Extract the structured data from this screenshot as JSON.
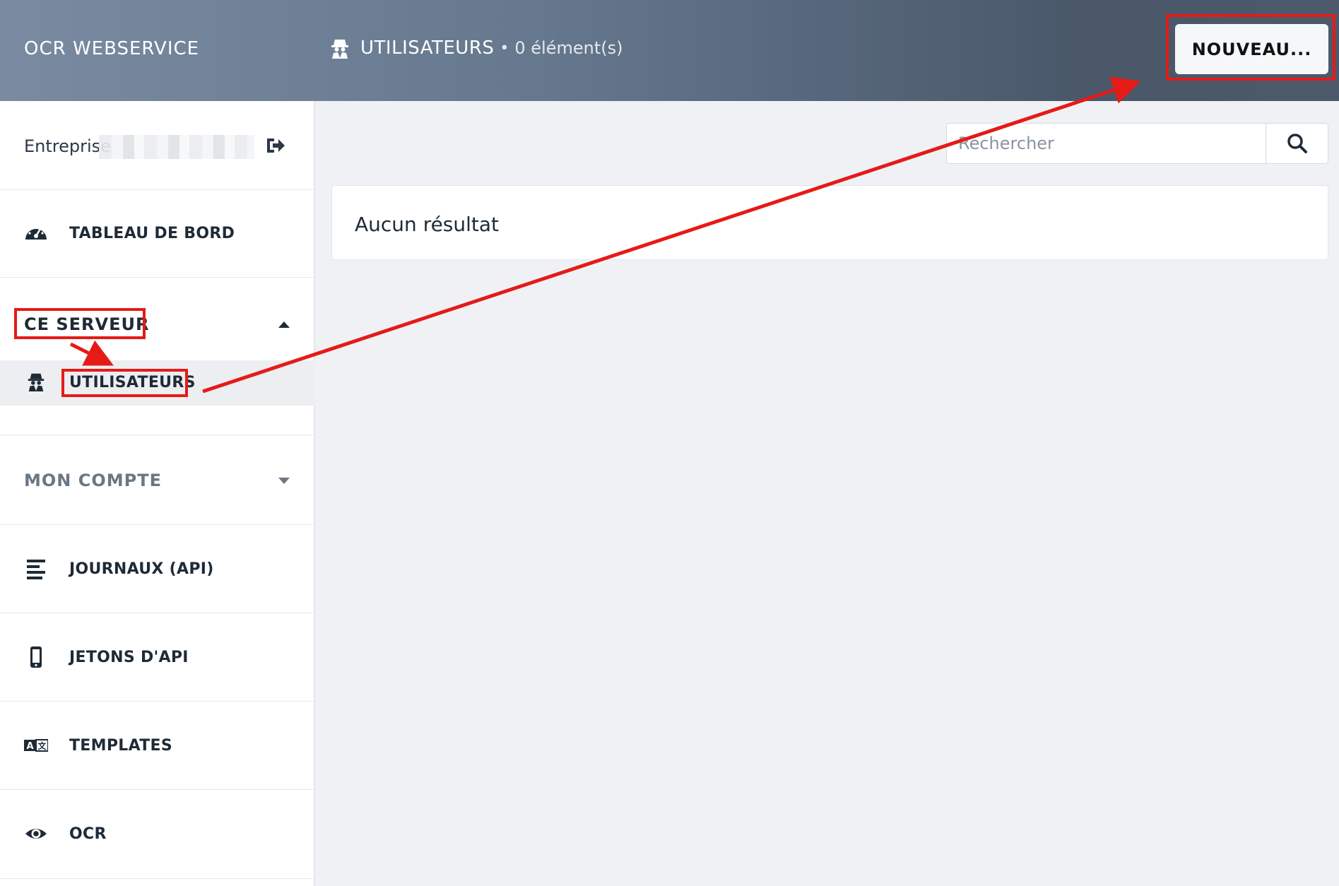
{
  "header": {
    "brand": "OCR WEBSERVICE",
    "title": "UTILISATEURS",
    "separator": "•",
    "count": "0 élément(s)",
    "new_button": "NOUVEAU..."
  },
  "sidebar": {
    "company_label": "Entreprise",
    "items": [
      {
        "label": "TABLEAU DE BORD",
        "icon": "dashboard-icon"
      },
      {
        "label": "UTILISATEURS",
        "icon": "user-secret-icon"
      },
      {
        "label": "JOURNAUX (API)",
        "icon": "align-left-icon"
      },
      {
        "label": "JETONS D'API",
        "icon": "mobile-icon"
      },
      {
        "label": "TEMPLATES",
        "icon": "translate-icon"
      },
      {
        "label": "OCR",
        "icon": "eye-icon"
      }
    ],
    "groups": {
      "server": "CE SERVEUR",
      "account": "MON COMPTE"
    }
  },
  "search": {
    "placeholder": "Rechercher"
  },
  "results": {
    "empty_text": "Aucun résultat"
  },
  "colors": {
    "annotation": "#e41b17",
    "header_start": "#7a8ba1",
    "header_end": "#4b596b",
    "background": "#eff1f5"
  }
}
